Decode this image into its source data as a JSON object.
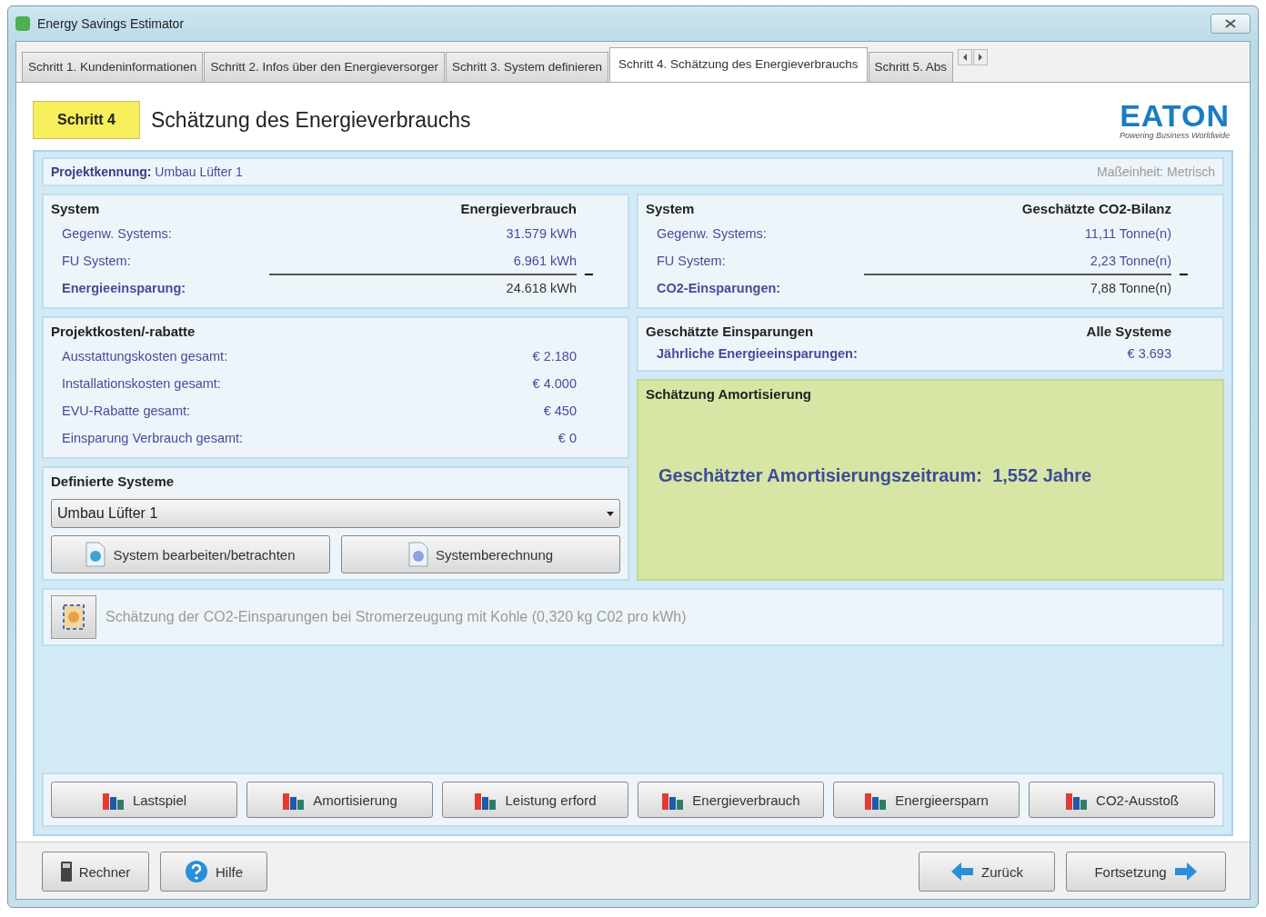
{
  "window": {
    "title": "Energy Savings Estimator"
  },
  "tabs": [
    {
      "label": "Schritt 1. Kundeninformationen",
      "selected": false
    },
    {
      "label": "Schritt 2. Infos über den Energieversorger",
      "selected": false
    },
    {
      "label": "Schritt 3. System definieren",
      "selected": false
    },
    {
      "label": "Schritt 4. Schätzung des Energieverbrauchs",
      "selected": true
    },
    {
      "label": "Schritt 5. Abs",
      "selected": false
    }
  ],
  "header": {
    "step_badge": "Schritt 4",
    "title": "Schätzung des Energieverbrauchs",
    "logo": "EATON",
    "logo_tagline": "Powering Business Worldwide"
  },
  "project": {
    "label": "Projektkennung:",
    "value": "Umbau Lüfter 1",
    "unit_label": "Maßeinheit:",
    "unit_value": "Metrisch"
  },
  "summaries": [
    {
      "heading": "System",
      "value_heading": "Energieverbrauch",
      "rows": [
        {
          "label": "Gegenw. Systems:",
          "value": "31.579 kWh"
        },
        {
          "label": "FU System:",
          "value": "6.961 kWh"
        }
      ],
      "operator": "−",
      "result": {
        "label": "Energieeinsparung:",
        "value": "24.618 kWh"
      }
    },
    {
      "heading": "System",
      "value_heading": "Geschätzte CO2-Bilanz",
      "rows": [
        {
          "label": "Gegenw. Systems:",
          "value": "11,11 Tonne(n)"
        },
        {
          "label": "FU System:",
          "value": "2,23 Tonne(n)"
        }
      ],
      "operator": "−",
      "result": {
        "label": "CO2-Einsparungen:",
        "value": "7,88 Tonne(n)"
      }
    }
  ],
  "costs": {
    "heading": "Projektkosten/-rabatte",
    "rows": [
      {
        "label": "Ausstattungskosten gesamt:",
        "value": "€ 2.180"
      },
      {
        "label": "Installationskosten gesamt:",
        "value": "€ 4.000"
      },
      {
        "label": "EVU-Rabatte gesamt:",
        "value": "€ 450"
      },
      {
        "label": "Einsparung Verbrauch gesamt:",
        "value": "€ 0"
      }
    ]
  },
  "savings": {
    "heading": "Geschätzte Einsparungen",
    "value_heading": "Alle Systeme",
    "rows": [
      {
        "label": "Jährliche Energieeinsparungen:",
        "value": "€ 3.693"
      }
    ]
  },
  "payback": {
    "heading": "Schätzung Amortisierung",
    "text": "Geschätzter Amortisierungszeitraum:  1,552 Jahre"
  },
  "defined_systems": {
    "heading": "Definierte Systeme",
    "selected_value": "Umbau Lüfter 1",
    "buttons": [
      "System bearbeiten/betrachten",
      "Systemberechnung"
    ]
  },
  "co2_note": "Schätzung der CO2-Einsparungen bei Stromerzeugung mit Kohle (0,320 kg C02 pro kWh)",
  "chart_buttons": [
    "Lastspiel",
    "Amortisierung",
    "Leistung erford",
    "Energieverbrauch",
    "Energieersparn",
    "CO2-Ausstoß"
  ],
  "footer": {
    "left_buttons": [
      {
        "kind": "calculator",
        "label": "Rechner"
      },
      {
        "kind": "help",
        "label": "Hilfe"
      }
    ],
    "back": "Zurück",
    "next": "Fortsetzung"
  }
}
